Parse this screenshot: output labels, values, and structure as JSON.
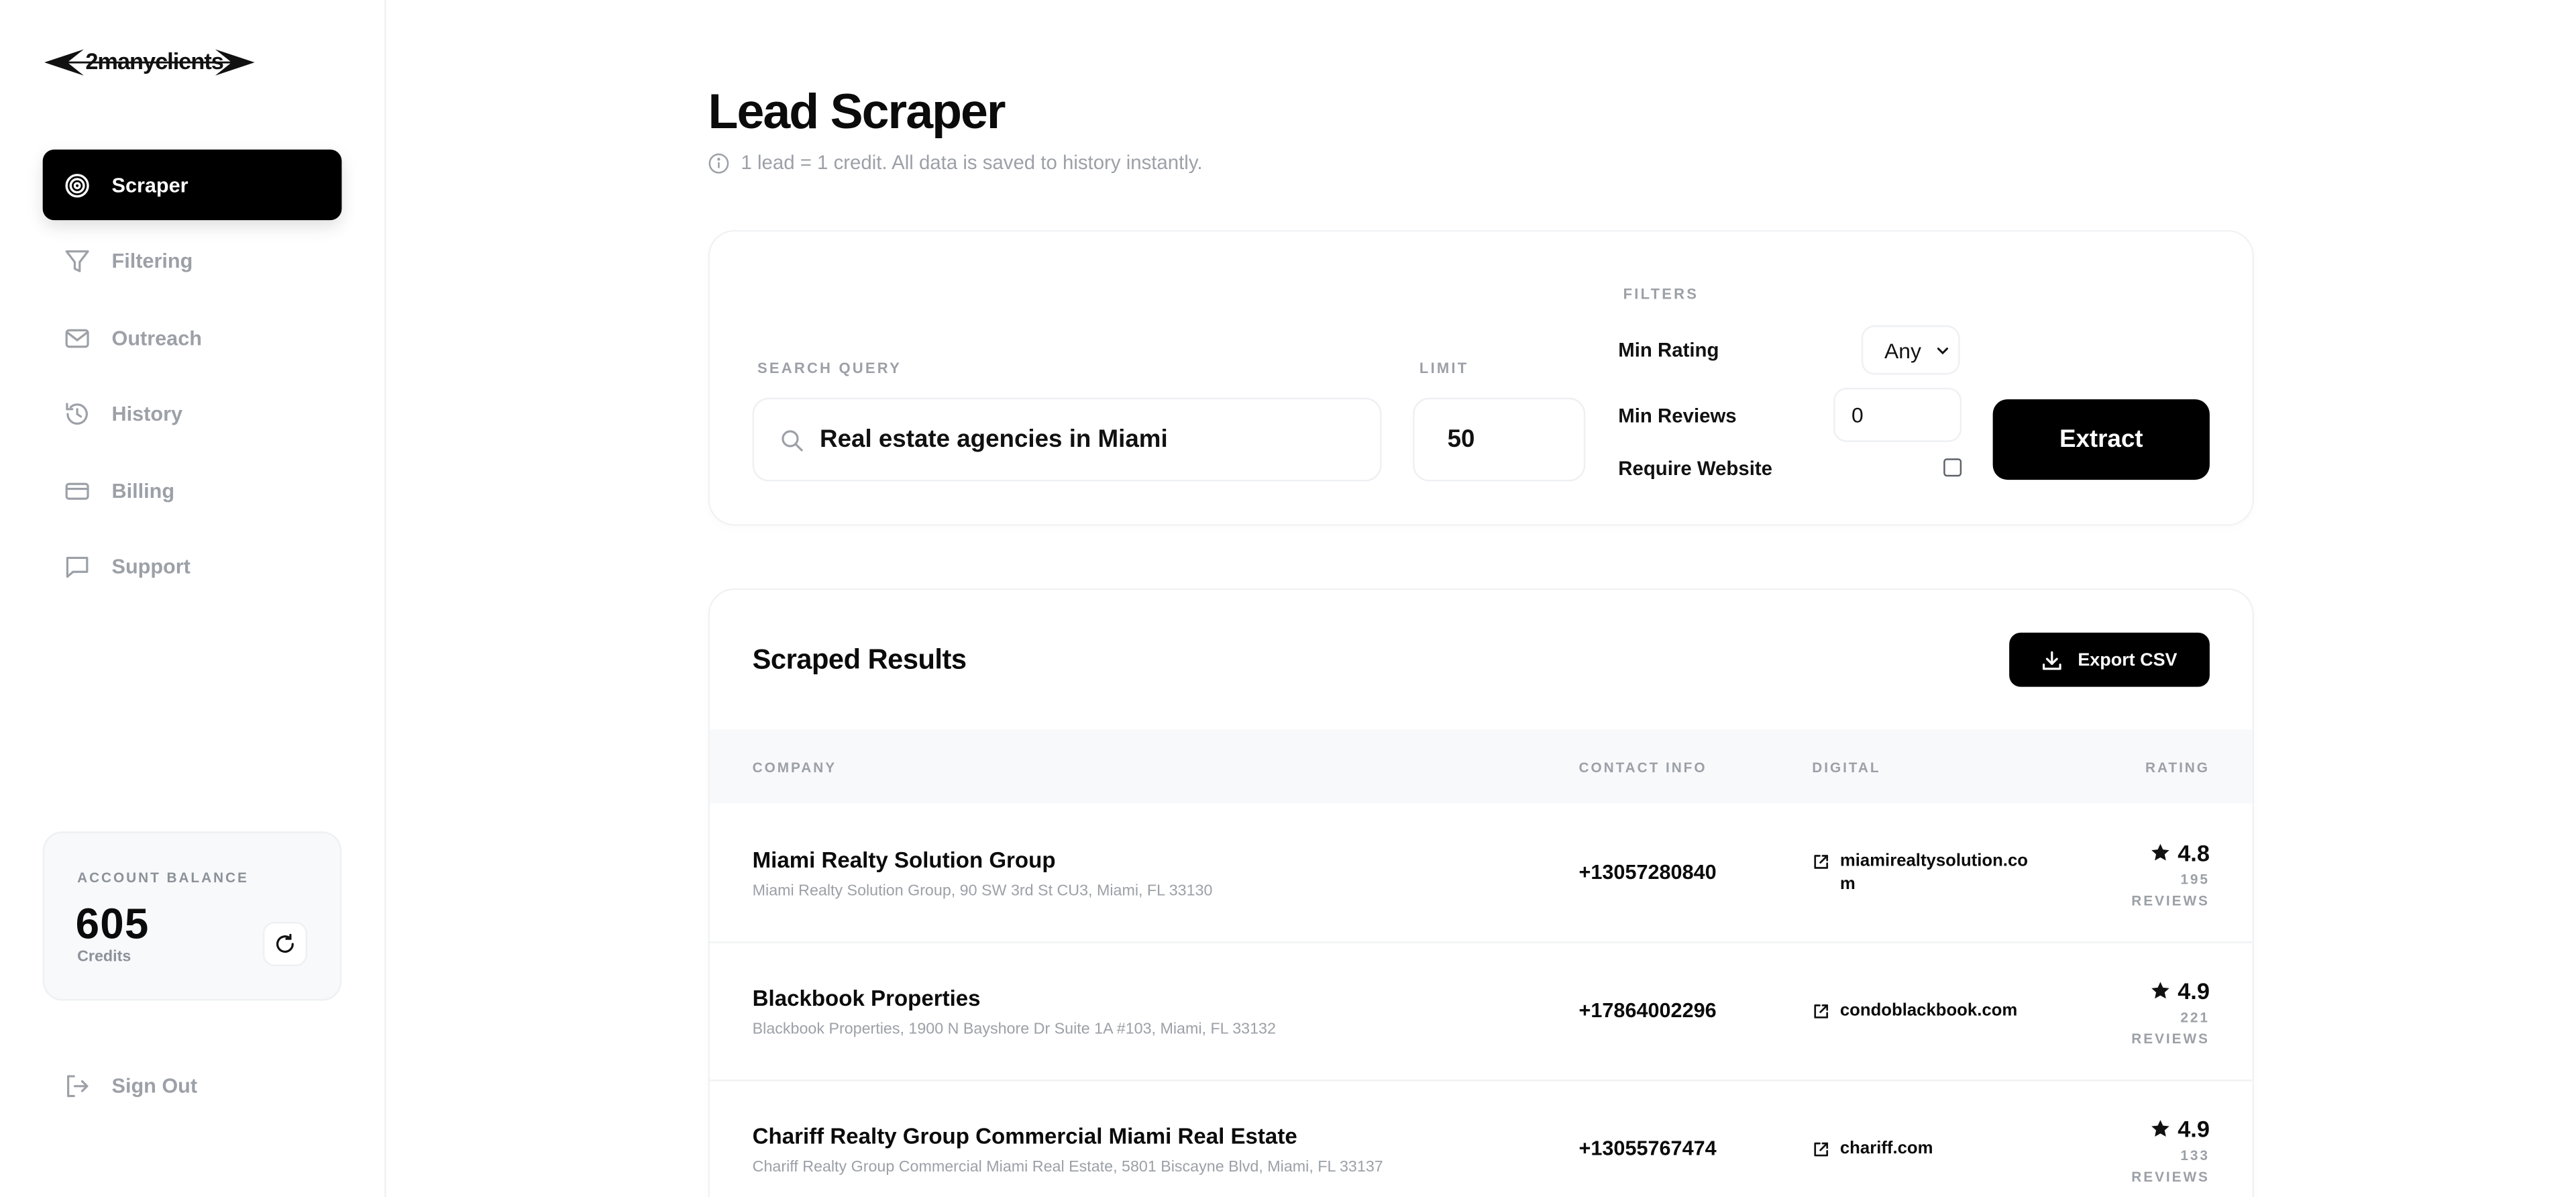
{
  "brand": {
    "name": "2manyclients"
  },
  "sidebar": {
    "items": [
      {
        "label": "Scraper",
        "icon": "target-icon",
        "active": true
      },
      {
        "label": "Filtering",
        "icon": "filter-icon",
        "active": false
      },
      {
        "label": "Outreach",
        "icon": "mail-icon",
        "active": false
      },
      {
        "label": "History",
        "icon": "history-icon",
        "active": false
      },
      {
        "label": "Billing",
        "icon": "credit-card-icon",
        "active": false
      },
      {
        "label": "Support",
        "icon": "message-icon",
        "active": false
      }
    ],
    "balance": {
      "label": "ACCOUNT BALANCE",
      "value": "605",
      "unit": "Credits"
    },
    "signout": "Sign Out"
  },
  "header": {
    "title": "Lead Scraper",
    "subtitle": "1 lead = 1 credit. All data is saved to history instantly."
  },
  "search": {
    "query_label": "SEARCH QUERY",
    "query_value": "Real estate agencies in Miami",
    "limit_label": "LIMIT",
    "limit_value": "50",
    "filters_label": "FILTERS",
    "min_rating_label": "Min Rating",
    "min_rating_value": "Any",
    "min_reviews_label": "Min Reviews",
    "min_reviews_value": "0",
    "require_website_label": "Require Website",
    "require_website_checked": false,
    "extract_label": "Extract"
  },
  "results": {
    "title": "Scraped Results",
    "export_label": "Export CSV",
    "columns": [
      "COMPANY",
      "CONTACT INFO",
      "DIGITAL",
      "RATING"
    ],
    "rows": [
      {
        "company": "Miami Realty Solution Group",
        "address": "Miami Realty Solution Group, 90 SW 3rd St CU3, Miami, FL 33130",
        "phone": "+13057280840",
        "website": "miamirealtysolution.com",
        "rating": "4.8",
        "reviews": "195",
        "reviews_unit": "REVIEWS"
      },
      {
        "company": "Blackbook Properties",
        "address": "Blackbook Properties, 1900 N Bayshore Dr Suite 1A #103, Miami, FL 33132",
        "phone": "+17864002296",
        "website": "condoblackbook.com",
        "rating": "4.9",
        "reviews": "221",
        "reviews_unit": "REVIEWS"
      },
      {
        "company": "Chariff Realty Group Commercial Miami Real Estate",
        "address": "Chariff Realty Group Commercial Miami Real Estate, 5801 Biscayne Blvd, Miami, FL 33137",
        "phone": "+13055767474",
        "website": "chariff.com",
        "rating": "4.9",
        "reviews": "133",
        "reviews_unit": "REVIEWS"
      }
    ]
  },
  "colors": {
    "accent": "#000000",
    "muted": "#9ca0a7",
    "surface": "#f8f9fb"
  }
}
